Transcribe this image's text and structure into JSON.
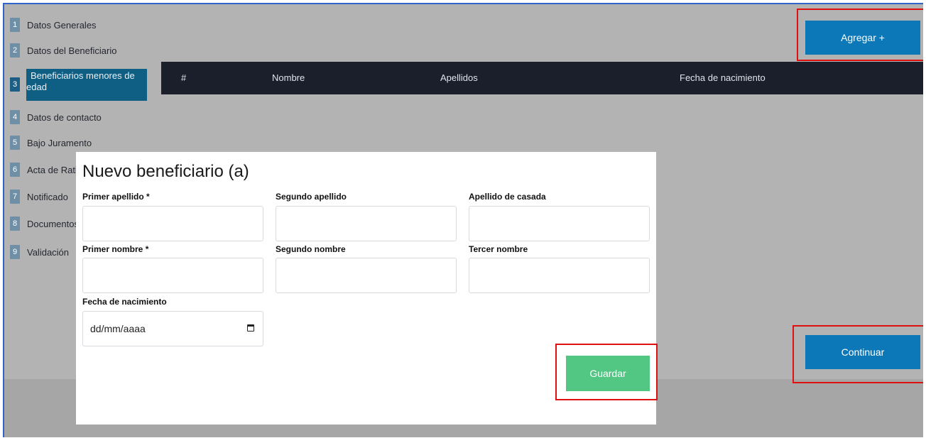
{
  "steps": [
    {
      "num": "1",
      "label": "Datos Generales"
    },
    {
      "num": "2",
      "label": "Datos del Beneficiario"
    },
    {
      "num": "3",
      "label_line1": "Beneficiarios menores de",
      "label_line2": "edad"
    },
    {
      "num": "4",
      "label": "Datos de contacto"
    },
    {
      "num": "5",
      "label": "Bajo Juramento"
    },
    {
      "num": "6",
      "label": "Acta de Rati"
    },
    {
      "num": "7",
      "label": "Notificado"
    },
    {
      "num": "8",
      "label": "Documentos"
    },
    {
      "num": "9",
      "label": "Validación"
    }
  ],
  "buttons": {
    "add": "Agregar +",
    "continue": "Continuar"
  },
  "table": {
    "columns": [
      "#",
      "Nombre",
      "Apellidos",
      "Fecha de nacimiento"
    ]
  },
  "modal": {
    "title": "Nuevo beneficiario (a)",
    "fields": {
      "first_surname": "Primer apellido *",
      "second_surname": "Segundo apellido",
      "married_surname": "Apellido de casada",
      "first_name": "Primer nombre *",
      "second_name": "Segundo nombre",
      "third_name": "Tercer nombre",
      "birth_date": "Fecha de nacimiento"
    },
    "date_placeholder": "dd/mm/aaaa",
    "save_label": "Guardar"
  },
  "colors": {
    "primary": "#0c78b8",
    "success": "#52c784",
    "table_header": "#1b1f2b",
    "highlight": "#e01010"
  }
}
